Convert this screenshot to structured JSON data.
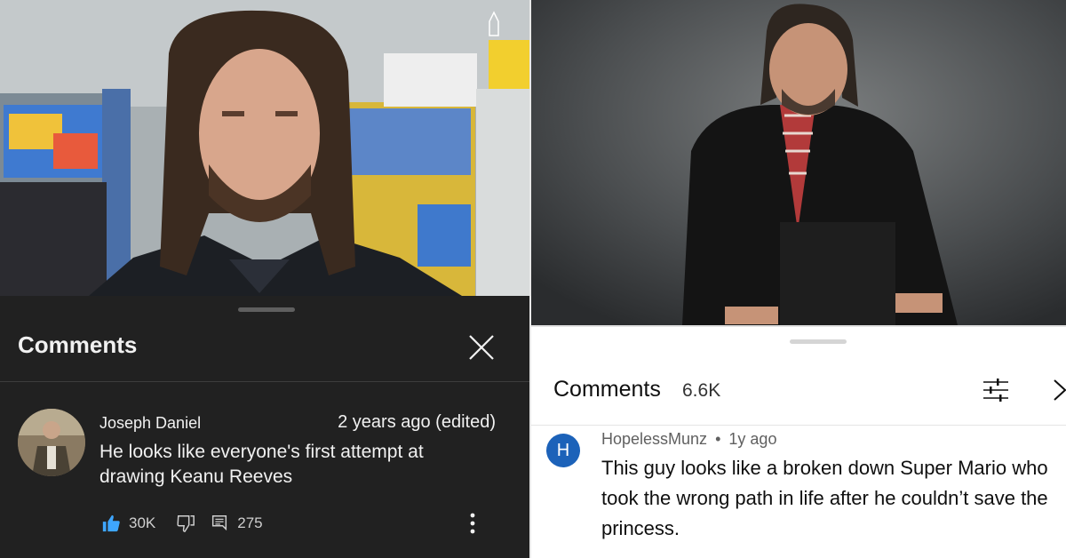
{
  "left_panel": {
    "sheet": {
      "title": "Comments"
    },
    "comment": {
      "author": "Joseph Daniel",
      "time": "2 years ago (edited)",
      "text": "He looks like everyone's first attempt at drawing Keanu Reeves",
      "likes": "30K",
      "replies": "275"
    },
    "icons": [
      "close-icon",
      "thumbs-up-icon",
      "thumbs-down-icon",
      "reply-icon",
      "more-vert-icon"
    ],
    "theme": {
      "background": "#212121",
      "text": "#f1f1f1",
      "like_active": "#3ea6ff"
    }
  },
  "right_panel": {
    "sheet": {
      "title": "Comments",
      "count": "6.6K"
    },
    "comment": {
      "avatar_letter": "H",
      "author": "HopelessMunz",
      "separator": "•",
      "time": "1y ago",
      "text": "This guy looks like a broken down Super Mario who took the wrong path in life after he couldn’t save the princess."
    },
    "icons": [
      "filter-icon",
      "close-chevron-icon"
    ],
    "theme": {
      "background": "#ffffff",
      "text": "#0f0f0f",
      "avatar": "#1c62b9"
    }
  }
}
